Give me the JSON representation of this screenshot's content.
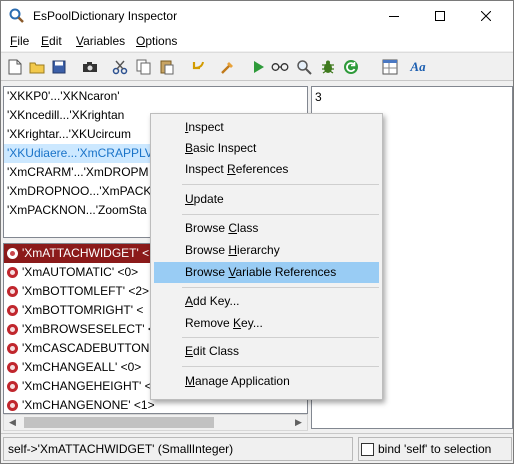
{
  "window": {
    "title": "EsPoolDictionary Inspector",
    "controls": {
      "minimize": "—",
      "maximize": "☐",
      "close": "✕"
    }
  },
  "menubar": [
    {
      "pre": "",
      "u": "F",
      "post": "ile"
    },
    {
      "pre": "",
      "u": "E",
      "post": "dit"
    },
    {
      "pre": "",
      "u": "V",
      "post": "ariables"
    },
    {
      "pre": "",
      "u": "O",
      "post": "ptions"
    }
  ],
  "toolbar": {
    "icons": [
      "new-file-icon",
      "open-folder-icon",
      "save-icon",
      "camera-icon",
      "cut-icon",
      "copy-icon",
      "paste-icon",
      "undo-icon",
      "reformat-icon",
      "run-icon",
      "spectacles-icon",
      "search-icon",
      "debug-bug-icon",
      "refresh-icon",
      "class-browser-icon",
      "font-icon"
    ],
    "font_label": "Aa"
  },
  "keys_list": {
    "items": [
      "'XKKP0'...'XKNcaron'",
      "'XKncedill...'XKrightan",
      "'XKrightar...'XKUcircum",
      "'XKUdiaere...'XmCRAPPLV",
      "'XmCRARM'...'XmDROPM",
      "'XmDROPNOO...'XmPACK",
      "'XmPACKNON...'ZoomSta"
    ],
    "selected_index": 3
  },
  "values_list": {
    "items": [
      "'XmATTACHWIDGET' <",
      "'XmAUTOMATIC' <0>",
      "'XmBOTTOMLEFT' <2>",
      "'XmBOTTOMRIGHT' <",
      "'XmBROWSESELECT' <",
      "'XmCASCADEBUTTON'",
      "'XmCHANGEALL' <0>",
      "'XmCHANGEHEIGHT' <",
      "'XmCHANGENONE' <1>"
    ],
    "selected_index": 0
  },
  "value_pane": {
    "text": "3"
  },
  "context_menu": {
    "items": [
      {
        "pre": "",
        "u": "I",
        "post": "nspect"
      },
      {
        "pre": "",
        "u": "B",
        "post": "asic Inspect"
      },
      {
        "pre": "Inspect ",
        "u": "R",
        "post": "eferences"
      },
      {
        "pre": "",
        "u": "U",
        "post": "pdate"
      },
      {
        "pre": "Browse ",
        "u": "C",
        "post": "lass"
      },
      {
        "pre": "Browse ",
        "u": "H",
        "post": "ierarchy"
      },
      {
        "pre": "Browse ",
        "u": "V",
        "post": "ariable References"
      },
      {
        "pre": "",
        "u": "A",
        "post": "dd Key..."
      },
      {
        "pre": "Remove ",
        "u": "K",
        "post": "ey..."
      },
      {
        "pre": "",
        "u": "E",
        "post": "dit Class"
      },
      {
        "pre": "",
        "u": "M",
        "post": "anage Application"
      }
    ],
    "highlighted_index": 6
  },
  "statusbar": {
    "text": "self->'XmATTACHWIDGET' (SmallInteger)",
    "checkbox_label": "bind 'self' to selection",
    "checkbox_checked": false
  },
  "colors": {
    "selection_blue": "#cce8ff",
    "selection_red": "#8b1a1a",
    "menu_highlight": "#99ccf4",
    "symbol_icon": "#c0262d"
  }
}
